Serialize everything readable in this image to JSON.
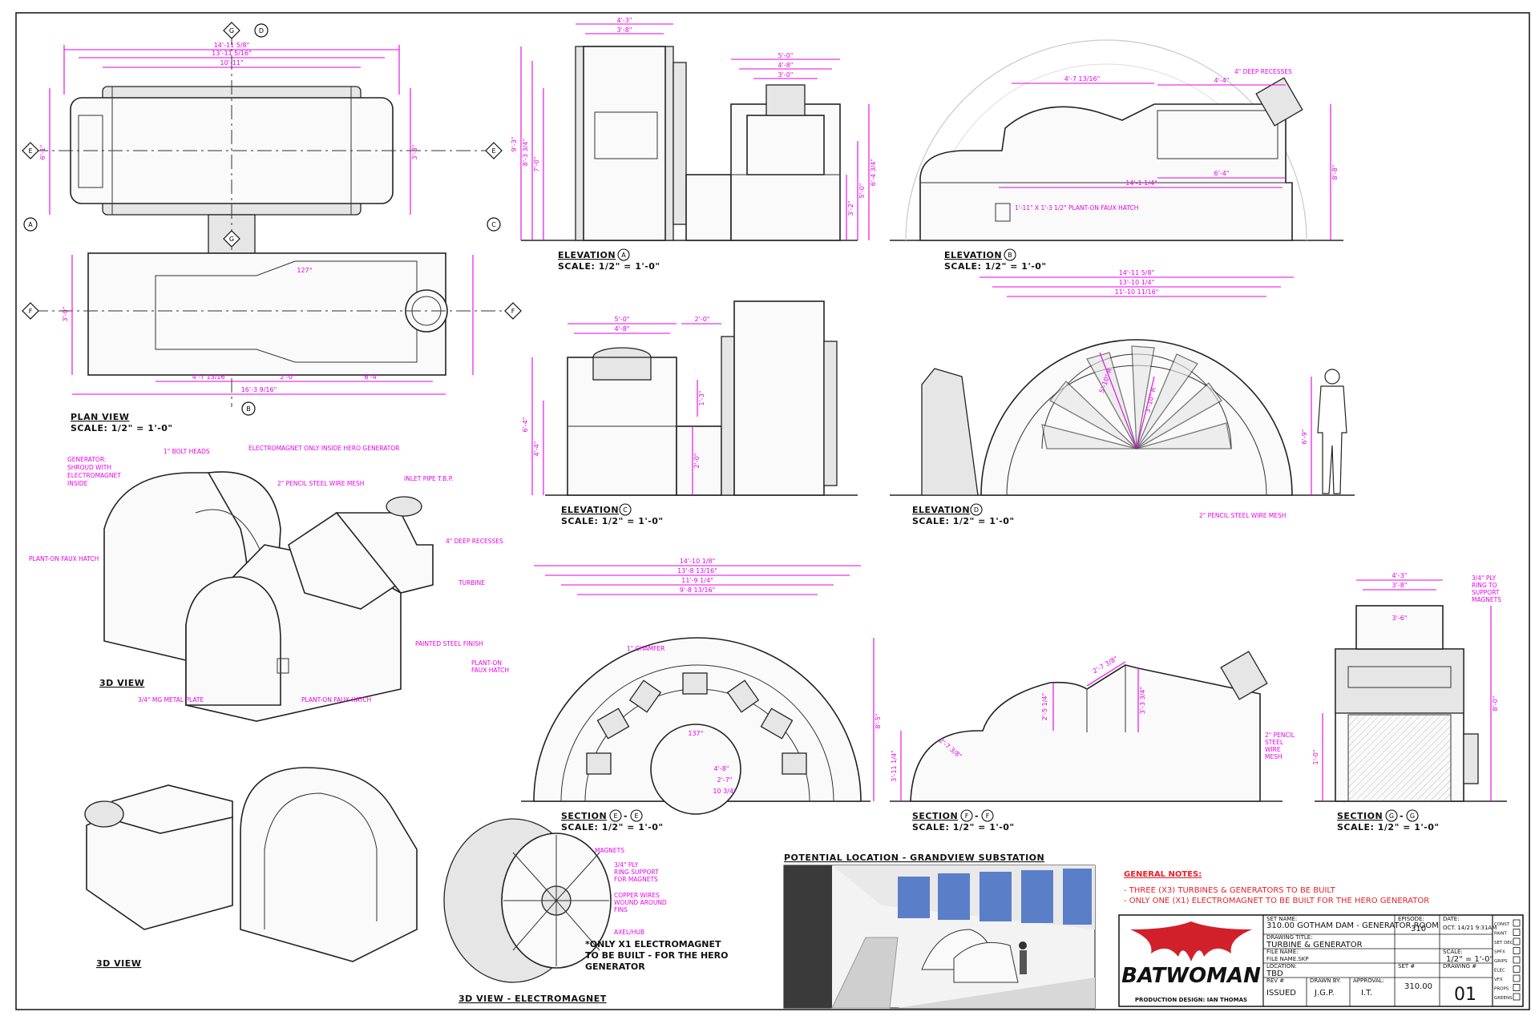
{
  "views": {
    "plan": {
      "title": "PLAN VIEW",
      "scale": "SCALE: 1/2\" = 1'-0\""
    },
    "elev_a": {
      "title": "ELEVATION",
      "marker": "A",
      "scale": "SCALE: 1/2\" = 1'-0\""
    },
    "elev_b": {
      "title": "ELEVATION",
      "marker": "B",
      "scale": "SCALE: 1/2\" = 1'-0\""
    },
    "elev_c": {
      "title": "ELEVATION",
      "marker": "C",
      "scale": "SCALE: 1/2\" = 1'-0\""
    },
    "elev_d": {
      "title": "ELEVATION",
      "marker": "D",
      "scale": "SCALE: 1/2\" = 1'-0\""
    },
    "sec_e": {
      "title": "SECTION",
      "marker": "E",
      "scale": "SCALE: 1/2\" = 1'-0\""
    },
    "sec_f": {
      "title": "SECTION",
      "marker": "F",
      "scale": "SCALE: 1/2\" = 1'-0\""
    },
    "sec_g": {
      "title": "SECTION",
      "marker": "G",
      "scale": "SCALE: 1/2\" = 1'-0\""
    },
    "view3d_a": {
      "title": "3D VIEW"
    },
    "view3d_b": {
      "title": "3D VIEW"
    },
    "view3d_em": {
      "title": "3D VIEW - ELECTROMAGNET"
    }
  },
  "plan_dims": {
    "top_overall": "14'-11 5/8\"",
    "top_2": "13'-11 5/16\"",
    "top_3": "10'-11\"",
    "bottom_a": "4'-7 13/16\"",
    "bottom_b": "2'-0\"",
    "bottom_c": "6'-4\"",
    "bottom_overall": "16'-3 9/16\"",
    "left_1": "6'-1\"",
    "right_1": "3'-3\"",
    "mid": "3'-0\"",
    "angle": "127°"
  },
  "elev_a_dims": {
    "w1": "4'-3\"",
    "w2": "3'-8\"",
    "w3": "5'-0\"",
    "w4": "4'-8\"",
    "w5": "3'-0\"",
    "h1": "9'-3\"",
    "h2": "8'-3 3/4\"",
    "h3": "7'-0\"",
    "h4": "6'-4 3/4\"",
    "h5": "5'-0\"",
    "h6": "3'-2\""
  },
  "elev_b_dims": {
    "a": "4'-7 13/16\"",
    "b": "4'-4\"",
    "c": "14'-1 1/4\"",
    "d": "6'-4\"",
    "e": "8'-8\"",
    "note_recess": "4\" DEEP RECESSES",
    "note_hatch": "1'-11\" X 1'-3 1/2\" PLANT-ON FAUX HATCH"
  },
  "elev_c_dims": {
    "a": "5'-0\"",
    "b": "4'-8\"",
    "c": "2'-0\"",
    "d": "6'-4\"",
    "e": "4'-4\"",
    "f": "2'-0\"",
    "g": "1'-3\""
  },
  "elev_d_dims": {
    "a": "14'-11 5/8\"",
    "b": "13'-10 1/4\"",
    "c": "11'-10 11/16\"",
    "h": "6'-9\"",
    "r1": "5'-10\" R",
    "r2": "3'-10\" R",
    "note": "2\" PENCIL STEEL WIRE MESH"
  },
  "sec_e_dims": {
    "a": "14'-10 1/8\"",
    "b": "13'-8 13/16\"",
    "c": "11'-9 1/4\"",
    "d": "9'-8 13/16\"",
    "e": "4'-8\"",
    "f": "2'-7\"",
    "g": "10 3/4\"",
    "h": "8'-5\"",
    "chamfer": "1\" CHAMFER",
    "angle": "137°",
    "note": "PLANT-ON FAUX HATCH"
  },
  "sec_f_dims": {
    "a": "2'-7 3/8\"",
    "b": "3'-3 3/4\"",
    "c": "6'-4\"",
    "d": "2'-5 1/4\"",
    "e": "3'-11 1/4\""
  },
  "sec_g_dims": {
    "a": "4'-3\"",
    "b": "3'-8\"",
    "c": "3'-6\"",
    "h": "8'-0\"",
    "d": "1'-0\"",
    "note_ply": "3/4\" PLY RING TO SUPPORT MAGNETS",
    "note_mesh": "2\" PENCIL STEEL WIRE MESH"
  },
  "callouts_3d": [
    "GENERATOR: SHROUD WITH ELECTROMAGNET INSIDE",
    "1\" BOLT HEADS",
    "ELECTROMAGNET ONLY INSIDE HERO GENERATOR",
    "2\" PENCIL STEEL WIRE MESH",
    "INLET PIPE T.B.P.",
    "4\" DEEP RECESSES",
    "TURBINE",
    "PLANT-ON FAUX HATCH",
    "PAINTED STEEL FINISH",
    "3/4\" MG METAL PLATE",
    "PLANT-ON FAUX HATCH"
  ],
  "callouts_em": [
    "MAGNETS",
    "3/4\" PLY RING SUPPORT FOR MAGNETS",
    "COPPER WIRES WOUND AROUND FINS",
    "AXEL/HUB"
  ],
  "em_note": "*ONLY X1 ELECTROMAGNET TO BE BUILT - FOR THE HERO GENERATOR",
  "location": {
    "title": "POTENTIAL LOCATION - GRANDVIEW SUBSTATION"
  },
  "general_notes": {
    "title": "GENERAL NOTES:",
    "items": [
      "- THREE (X3) TURBINES & GENERATORS TO BE BUILT",
      "- ONLY ONE (X1) ELECTROMAGNET TO BE BUILT FOR THE HERO GENERATOR"
    ]
  },
  "title_block": {
    "logo": "BATWOMAN",
    "credit": "PRODUCTION DESIGN: IAN THOMAS",
    "set_name_label": "SET NAME:",
    "set_name": "310.00 GOTHAM DAM - GENERATOR ROOM",
    "episode_label": "EPISODE:",
    "episode": "310",
    "date_label": "DATE:",
    "date": "OCT. 14/21 9:31AM",
    "drawing_title_label": "DRAWING TITLE:",
    "drawing_title": "TURBINE & GENERATOR",
    "file_label": "FILE NAME:",
    "file": "FILE NAME.SKP",
    "scale_label": "SCALE:",
    "scale": "1/2\" = 1'-0\"",
    "location_label": "LOCATION:",
    "location": "TBD",
    "rev_label": "REV #",
    "rev": "ISSUED",
    "drawn_label": "DRAWN BY:",
    "drawn": "J.G.P.",
    "approval_label": "APPROVAL:",
    "approval": "I.T.",
    "set_no_label": "SET #",
    "set_no": "310.00",
    "drawing_no_label": "DRAWING #",
    "drawing_no": "01",
    "checklist": [
      "CONST",
      "PAINT",
      "SET DEC",
      "SPFX",
      "GRIPS",
      "ELEC",
      "VFX",
      "PROPS",
      "GREENS"
    ]
  },
  "section_markers": {
    "e": "E",
    "f": "F",
    "g": "G",
    "a": "A",
    "b": "B",
    "c": "C",
    "d": "D"
  }
}
